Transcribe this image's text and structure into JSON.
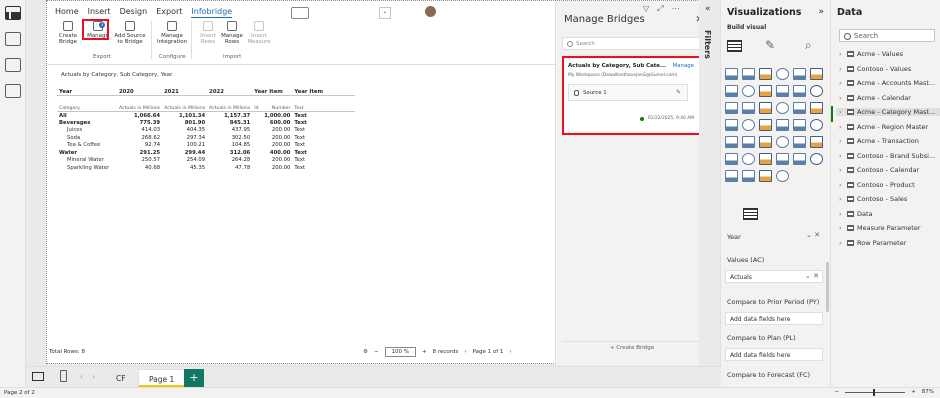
{
  "ribbon": {
    "tabs": [
      "Home",
      "Insert",
      "Design",
      "Export",
      "Infobridge"
    ],
    "buttons": {
      "create": "Create Bridge",
      "manage": "Manage",
      "add_source": "Add Source to Bridge",
      "manage_integration": "Manage Integration",
      "insert_rows": "Insert Rows",
      "manage_rows": "Manage Rows",
      "insert_measure": "Insert Measure"
    },
    "groups": [
      "Export",
      "Configure",
      "Import"
    ],
    "manage_badge": "3"
  },
  "visual": {
    "title": "Actuals by Category, Sub Category, Year",
    "col_groups": [
      "Year",
      "2020",
      "2021",
      "2022",
      "Year Item",
      "Year Item"
    ],
    "col_subs": [
      "Category",
      "Actuals in Millions",
      "Actuals in Millions",
      "Actuals in Millions",
      "Id",
      "Number",
      "Text"
    ],
    "rows": [
      {
        "label": "All",
        "vals": [
          "1,066.64",
          "1,101.34",
          "1,157.37",
          "1,000.00",
          "Text"
        ],
        "kind": "b"
      },
      {
        "label": "Beverages",
        "vals": [
          "775.39",
          "801.90",
          "845.31",
          "600.00",
          "Text"
        ],
        "kind": "b"
      },
      {
        "label": "Juices",
        "vals": [
          "414.03",
          "404.35",
          "437.95",
          "200.00",
          "Text"
        ],
        "kind": "ind"
      },
      {
        "label": "Soda",
        "vals": [
          "268.62",
          "297.34",
          "302.50",
          "200.00",
          "Text"
        ],
        "kind": "ind"
      },
      {
        "label": "Tea & Coffee",
        "vals": [
          "92.74",
          "100.21",
          "104.85",
          "200.00",
          "Text"
        ],
        "kind": "ind"
      },
      {
        "label": "Water",
        "vals": [
          "291.25",
          "299.44",
          "312.06",
          "400.00",
          "Text"
        ],
        "kind": "b"
      },
      {
        "label": "Mineral Water",
        "vals": [
          "250.57",
          "254.09",
          "264.28",
          "200.00",
          "Text"
        ],
        "kind": "ind"
      },
      {
        "label": "Sparkling Water",
        "vals": [
          "40.68",
          "45.35",
          "47.78",
          "200.00",
          "Text"
        ],
        "kind": "ind"
      }
    ],
    "footer": "Total Rows: 8",
    "zoom": "100 %",
    "records": "8 records",
    "page_nav": "Page 1 of 1"
  },
  "manage_bridges": {
    "title": "Manage Bridges",
    "search_placeholder": "Search",
    "card": {
      "title": "Actuals by Category, Sub Cate...",
      "manage": "Manage",
      "workspace": "My Workspace (DewaKanthavejanG@Gumel.com)",
      "source": "Source 1",
      "date": "01/22/2025, 9:40 AM"
    },
    "create": "+ Create Bridge"
  },
  "filters": {
    "label": "Filters"
  },
  "visualizations": {
    "title": "Visualizations",
    "build": "Build visual",
    "fields": [
      {
        "label": "Year",
        "value": ""
      },
      {
        "label": "Values (AC)",
        "value": "Actuals"
      },
      {
        "label": "Compare to Prior Period (PY)",
        "value": "Add data fields here"
      },
      {
        "label": "Compare to Plan (PL)",
        "value": "Add data fields here"
      },
      {
        "label": "Compare to Forecast (FC)",
        "value": ""
      }
    ]
  },
  "data_pane": {
    "title": "Data",
    "search_placeholder": "Search",
    "items": [
      "Acme - Values",
      "Contoso - Values",
      "Acme - Accounts Mast...",
      "Acme - Calendar",
      "Acme - Category Mast...",
      "Acme - Region Master",
      "Acme - Transaction",
      "Contoso - Brand Subsi...",
      "Contoso - Calendar",
      "Contoso - Product",
      "Contoso - Sales",
      "Data",
      "Measure Parameter",
      "Row Parameter"
    ]
  },
  "pages": {
    "tabs": [
      "CF",
      "Page 1"
    ],
    "add": "+"
  },
  "status": {
    "page": "Page 2 of 2",
    "zoom": "87%"
  },
  "colors": {
    "accent": "#1e6bb8",
    "highlight": "#e81123",
    "add_page": "#117865",
    "active_tab": "#f2c811"
  }
}
